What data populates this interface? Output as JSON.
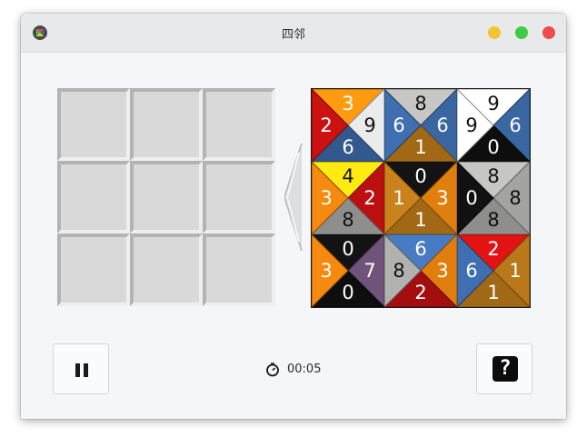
{
  "window": {
    "title": "四邻"
  },
  "window_buttons": [
    "minimize",
    "maximize",
    "close"
  ],
  "colors": {
    "0": "#111111",
    "1": "#c9821c",
    "2": "#cc1111",
    "3": "#f58a0f",
    "4": "#ecd20f",
    "6": "#3f6fb0",
    "7": "#7a5a86",
    "8": "#b1b1af",
    "9": "#ffffff"
  },
  "board": {
    "rows": 3,
    "cols": 3,
    "filled": 0
  },
  "tiles": [
    {
      "top": "3",
      "right": "9",
      "bottom": "6",
      "left": "2"
    },
    {
      "top": "8",
      "right": "6",
      "bottom": "1",
      "left": "6"
    },
    {
      "top": "9",
      "right": "6",
      "bottom": "0",
      "left": "9"
    },
    {
      "top": "4",
      "right": "2",
      "bottom": "8",
      "left": "3"
    },
    {
      "top": "0",
      "right": "3",
      "bottom": "1",
      "left": "1"
    },
    {
      "top": "8",
      "right": "8",
      "bottom": "8",
      "left": "0"
    },
    {
      "top": "0",
      "right": "7",
      "bottom": "0",
      "left": "3"
    },
    {
      "top": "6",
      "right": "3",
      "bottom": "2",
      "left": "8"
    },
    {
      "top": "2",
      "right": "1",
      "bottom": "1",
      "left": "6"
    }
  ],
  "controls": {
    "pause_icon": "pause-icon",
    "help_icon": "help-icon",
    "help_glyph": "?"
  },
  "timer": {
    "icon": "clock-icon",
    "elapsed": "00:05"
  }
}
